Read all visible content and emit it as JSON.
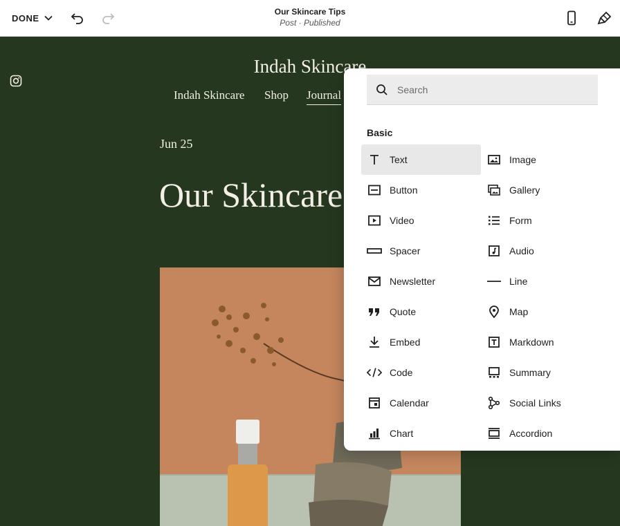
{
  "topbar": {
    "done_label": "DONE",
    "page_title": "Our Skincare Tips",
    "page_status": "Post · Published"
  },
  "site": {
    "brand": "Indah Skincare",
    "nav": [
      "Indah Skincare",
      "Shop",
      "Journal"
    ],
    "active_nav": "Journal",
    "post_date": "Jun 25",
    "post_title": "Our Skincare Tips",
    "colors": {
      "background": "#25381f",
      "text": "#f3efe6"
    }
  },
  "panel": {
    "search_placeholder": "Search",
    "section": "Basic",
    "selected": "Text",
    "left_items": [
      {
        "label": "Text",
        "icon": "text-icon"
      },
      {
        "label": "Button",
        "icon": "button-icon"
      },
      {
        "label": "Video",
        "icon": "video-icon"
      },
      {
        "label": "Spacer",
        "icon": "spacer-icon"
      },
      {
        "label": "Newsletter",
        "icon": "envelope-icon"
      },
      {
        "label": "Quote",
        "icon": "quote-icon"
      },
      {
        "label": "Embed",
        "icon": "embed-icon"
      },
      {
        "label": "Code",
        "icon": "code-icon"
      },
      {
        "label": "Calendar",
        "icon": "calendar-icon"
      },
      {
        "label": "Chart",
        "icon": "chart-icon"
      }
    ],
    "right_items": [
      {
        "label": "Image",
        "icon": "image-icon"
      },
      {
        "label": "Gallery",
        "icon": "gallery-icon"
      },
      {
        "label": "Form",
        "icon": "form-icon"
      },
      {
        "label": "Audio",
        "icon": "audio-icon"
      },
      {
        "label": "Line",
        "icon": "line-icon"
      },
      {
        "label": "Map",
        "icon": "map-pin-icon"
      },
      {
        "label": "Markdown",
        "icon": "markdown-icon"
      },
      {
        "label": "Summary",
        "icon": "summary-icon"
      },
      {
        "label": "Social Links",
        "icon": "social-links-icon"
      },
      {
        "label": "Accordion",
        "icon": "accordion-icon"
      }
    ]
  }
}
